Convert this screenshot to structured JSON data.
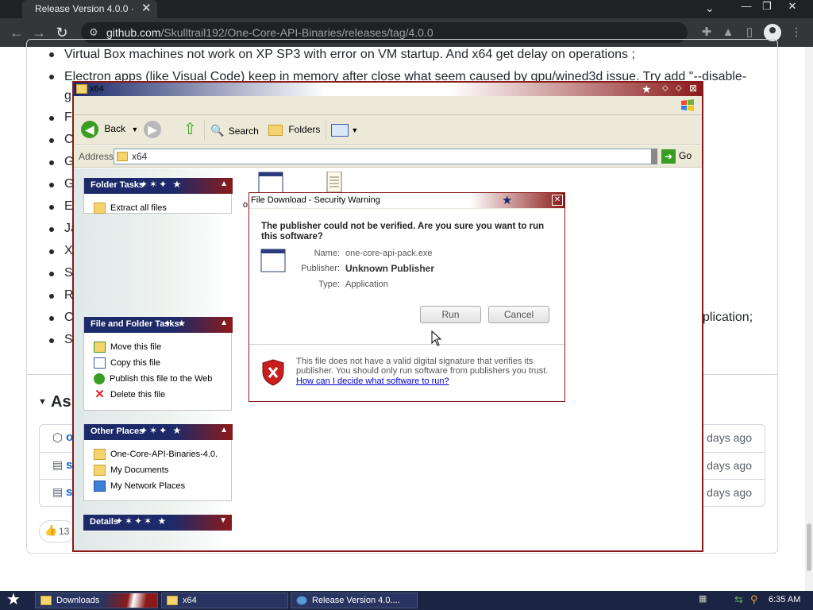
{
  "browser": {
    "tab_title": "Release Version 4.0.0 · Sk",
    "tab_close": "✕",
    "tabs_dropdown": "⌄",
    "window_controls": [
      "—",
      "❐",
      "✕"
    ],
    "url_host": "github.com",
    "url_path": "/Skulltrail192/One-Core-API-Binaries/releases/tag/4.0.0",
    "icons": [
      "back-icon",
      "forward-icon",
      "reload-icon",
      "tune-icon",
      "extensions-icon",
      "labs-icon",
      "sidepanel-icon",
      "profile-icon",
      "menu-icon"
    ]
  },
  "github": {
    "lines": [
      "Virtual Box machines not work on XP SP3 with error on VM startup. And x64 get delay on operations ;",
      "Electron apps (like Visual Code) keep in memory after close what seem caused by gpu/wined3d issue. Try add \"--disable-",
      "g",
      "Fi",
      "C",
      "G",
      "G",
      "Es",
      "Ja",
      "X",
      "Sc",
      "R",
      "C",
      "Sc"
    ],
    "partial_right": "plication;",
    "assets_heading": "Ass",
    "asset_dates": [
      "days ago",
      "days ago",
      "days ago"
    ],
    "asset_prefixes": [
      "o",
      "s",
      "s"
    ],
    "reaction_count": "13"
  },
  "explorer": {
    "title": "x64",
    "toolbar": {
      "back": "Back",
      "search": "Search",
      "folders": "Folders"
    },
    "address_label": "Address",
    "address_value": "x64",
    "go_label": "Go",
    "panels": [
      {
        "title": "Folder Tasks",
        "items": [
          {
            "label": "Extract all files",
            "icon": "extract-icon"
          }
        ]
      },
      {
        "title": "File and Folder Tasks",
        "items": [
          {
            "label": "Move this file",
            "icon": "move-icon"
          },
          {
            "label": "Copy this file",
            "icon": "copy-icon"
          },
          {
            "label": "Publish this file to the Web",
            "icon": "globe-icon"
          },
          {
            "label": "Delete this file",
            "icon": "delete-icon"
          }
        ]
      },
      {
        "title": "Other Places",
        "items": [
          {
            "label": "One-Core-API-Binaries-4.0.",
            "icon": "folder-icon"
          },
          {
            "label": "My Documents",
            "icon": "documents-icon"
          },
          {
            "label": "My Network Places",
            "icon": "network-icon"
          }
        ]
      },
      {
        "title": "Details",
        "items": []
      }
    ],
    "content_fragment": "o"
  },
  "dialog": {
    "title": "File Download - Security Warning",
    "heading": "The publisher could not be verified.  Are you sure you want to run this software?",
    "name_label": "Name:",
    "name_value": "one-core-api-pack.exe",
    "publisher_label": "Publisher:",
    "publisher_value": "Unknown Publisher",
    "type_label": "Type:",
    "type_value": "Application",
    "run_label": "Run",
    "cancel_label": "Cancel",
    "warning_text": "This file does not have a valid digital signature that verifies its publisher.  You should only run software from publishers you trust.",
    "help_link": "How can I decide what software to run?"
  },
  "taskbar": {
    "tasks": [
      "Downloads",
      "x64",
      "Release Version 4.0...."
    ],
    "clock": "6:35 AM"
  },
  "colors": {
    "chrome_dark": "#202124",
    "xp_blue": "#1c2a6a",
    "xp_red": "#8b1a1a",
    "link_blue": "#0000cc"
  }
}
